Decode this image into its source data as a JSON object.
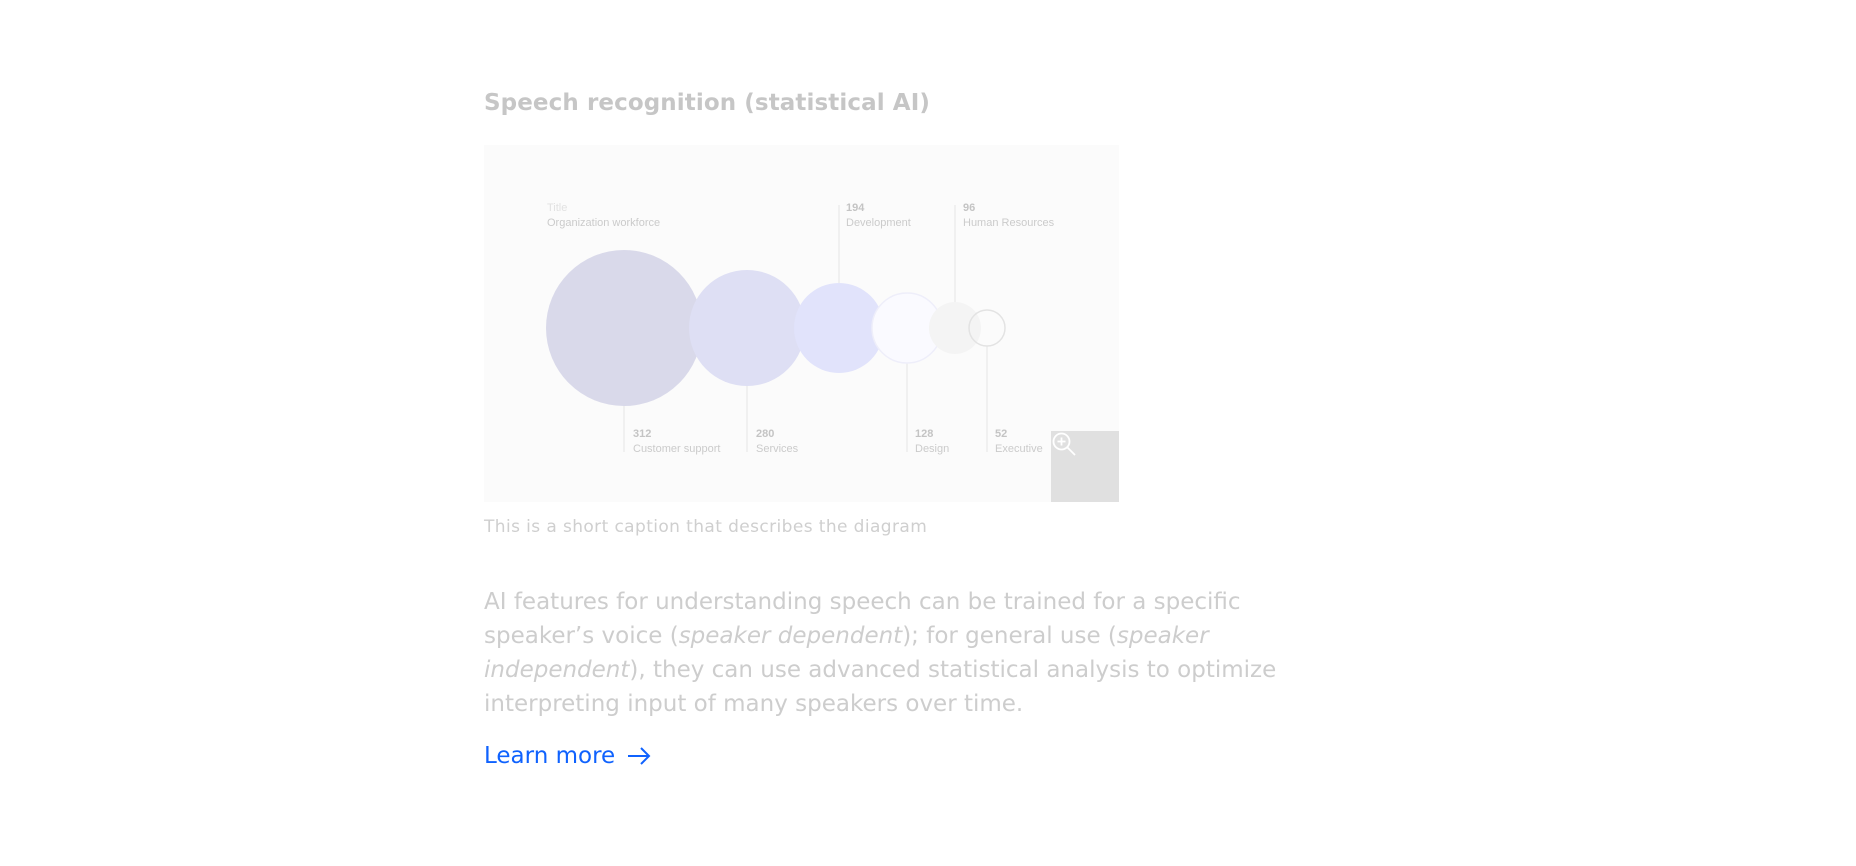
{
  "section": {
    "title": "Speech recognition (statistical AI)"
  },
  "diagram": {
    "title_label": "Title",
    "subtitle_label": "Organization workforce",
    "items": [
      {
        "value": "312",
        "label": "Customer support"
      },
      {
        "value": "280",
        "label": "Services"
      },
      {
        "value": "194",
        "label": "Development"
      },
      {
        "value": "128",
        "label": "Design"
      },
      {
        "value": "96",
        "label": "Human Resources"
      },
      {
        "value": "52",
        "label": "Executive"
      }
    ],
    "zoom_icon": "zoom-in-icon"
  },
  "caption": "This is a short caption that describes the diagram",
  "body": {
    "part1": "AI features for understanding speech can be trained for a specific speaker’s voice (",
    "em1": "speaker dependent",
    "part2": "); for general use (",
    "em2": "speaker independent",
    "part3": "), they can use advanced statistical analysis to optimize interpreting input of many speakers over time."
  },
  "link": {
    "label": "Learn more",
    "icon": "arrow-right-icon"
  },
  "colors": {
    "link": "#0f62fe",
    "muted_text": "#cdcdcd",
    "zoom_bg": "#e0e0e0"
  }
}
